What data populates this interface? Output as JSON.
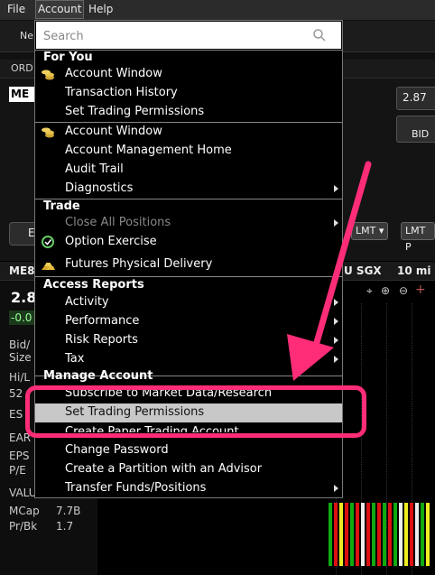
{
  "menubar": {
    "file": "File",
    "account": "Account",
    "help": "Help"
  },
  "background": {
    "toolbar_partial": "Ne",
    "ord_label": "ORD",
    "symbol": "ME",
    "price_btn": "2.87",
    "bid_label": "BID",
    "lmt1": "LMT",
    "lmt2": "LMT P",
    "radio_partial": "E",
    "symbol_bar": "ME8",
    "exchange": "U SGX",
    "interval": "10 mi",
    "big_price": "2.8",
    "change": "-0.0",
    "left_labels": [
      "Bid/",
      "Size",
      "Hi/L",
      "52",
      "ES",
      "EAR",
      "EPS",
      "P/E",
      "VALU"
    ],
    "mcap_label": "MCap",
    "mcap_value": "7.7B",
    "prbk_label": "Pr/Bk",
    "prbk_value": "1.7"
  },
  "menu": {
    "search_placeholder": "Search",
    "sections": {
      "for_you": "For You",
      "trade": "Trade",
      "access_reports": "Access Reports",
      "manage_account": "Manage Account"
    },
    "items": {
      "account_window_1": "Account Window",
      "transaction_history": "Transaction History",
      "set_trading_permissions_1": "Set Trading Permissions",
      "account_window_2": "Account Window",
      "account_management_home": "Account Management Home",
      "audit_trail": "Audit Trail",
      "diagnostics": "Diagnostics",
      "close_all_positions": "Close All Positions",
      "option_exercise": "Option Exercise",
      "futures_physical_delivery": "Futures Physical Delivery",
      "activity": "Activity",
      "performance": "Performance",
      "risk_reports": "Risk Reports",
      "tax": "Tax",
      "subscribe_market_data": "Subscribe to Market Data/Research",
      "set_trading_permissions_2": "Set Trading Permissions",
      "create_paper_trading": "Create Paper Trading Account",
      "change_password": "Change Password",
      "create_partition": "Create a Partition with an Advisor",
      "transfer_funds": "Transfer Funds/Positions"
    }
  },
  "annotation": {
    "color": "#ff2d78"
  }
}
